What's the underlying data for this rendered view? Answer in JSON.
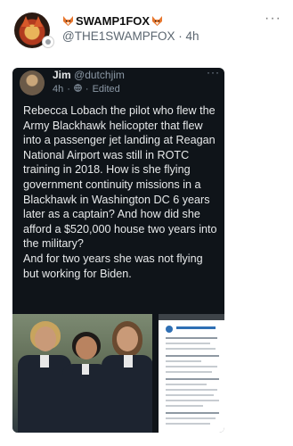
{
  "post": {
    "display_name": "SWAMP1FOX",
    "handle": "@THE1SWAMPFOX",
    "separator": "·",
    "time": "4h",
    "more_icon": "ellipsis-icon"
  },
  "embedded_tweet": {
    "author_name": "Jim",
    "author_handle": "@dutchjim",
    "time": "4h",
    "separator": "·",
    "edited": "Edited",
    "paragraphs": [
      "Rebecca Lobach the pilot who flew the Army Blackhawk helicopter that flew into a passenger jet landing at Reagan National Airport was still in ROTC training in 2018. How is she flying government continuity missions in a Blackhawk in Washington DC 6 years later as a captain? And how did she afford a $520,000 house two years into the military?",
      "And for two years she was not flying but working for Biden."
    ],
    "icons": {
      "more": "ellipsis-icon",
      "globe": "globe-icon"
    }
  },
  "colors": {
    "dark_bg": "#0f1419",
    "handle_gray": "#5b6670",
    "fox_orange": "#e8772e"
  }
}
